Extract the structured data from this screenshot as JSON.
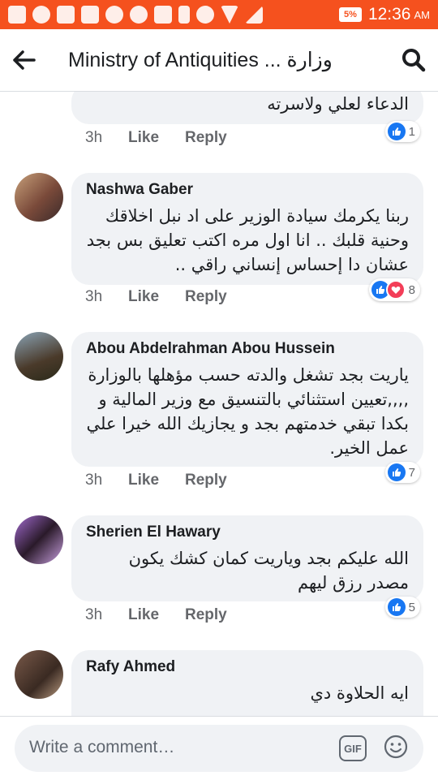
{
  "status_bar": {
    "battery": "5%",
    "time": "12:36",
    "ampm": "AM"
  },
  "header": {
    "title": "Ministry of Antiquities ... وزارة"
  },
  "partial_comment": {
    "text": "الدعاء لعلي ولاسرته",
    "time": "3h",
    "like": "Like",
    "reply": "Reply",
    "reactions": "1"
  },
  "comments": [
    {
      "author": "Nashwa Gaber",
      "text": "ربنا يكرمك سيادة الوزير على اد نبل اخلاقك وحنية قلبك .. انا اول مره اكتب تعليق بس بجد عشان دا إحساس إنساني راقي ..",
      "time": "3h",
      "like": "Like",
      "reply": "Reply",
      "reactions": "8"
    },
    {
      "author": "Abou Abdelrahman Abou Hussein",
      "text": "ياريت بجد تشغل والدته حسب مؤهلها بالوزارة ,,,,تعيين استثنائي بالتنسيق مع وزير المالية و بكدا تبقي خدمتهم بجد و يجازيك الله خيرا علي عمل الخير.",
      "time": "3h",
      "like": "Like",
      "reply": "Reply",
      "reactions": "7"
    },
    {
      "author": "Sherien El Hawary",
      "text": "الله عليكم بجد وياريت كمان كشك يكون مصدر رزق ليهم",
      "time": "3h",
      "like": "Like",
      "reply": "Reply",
      "reactions": "5"
    },
    {
      "author": "Rafy Ahmed",
      "text": "ايه الحلاوة دي",
      "time": "",
      "like": "",
      "reply": "",
      "reactions": ""
    }
  ],
  "composer": {
    "placeholder": "Write a comment…",
    "gif": "GIF"
  },
  "colors": {
    "status_bar": "#f5511e",
    "like_blue": "#1877f2",
    "love_red": "#f33e58",
    "bubble": "#f0f2f5"
  }
}
